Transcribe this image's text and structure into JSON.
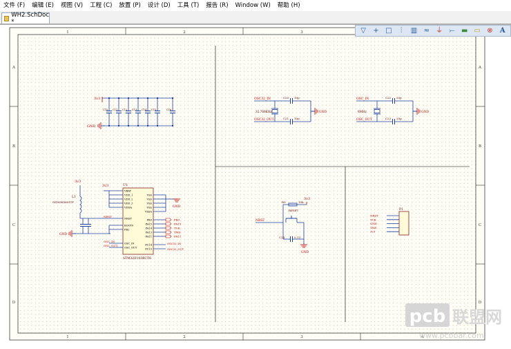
{
  "menu": [
    "文件 (F)",
    "编辑 (E)",
    "视图 (V)",
    "工程 (C)",
    "放置 (P)",
    "设计 (D)",
    "工具 (T)",
    "报告 (R)",
    "Window (W)",
    "帮助 (H)"
  ],
  "tab": {
    "title": "WH2.SchDoc *"
  },
  "toolbar": {
    "icons": [
      "filter-icon",
      "cross-icon",
      "rectangle-select-icon",
      "align-icon",
      "component-icon",
      "wire-icon",
      "power-port-icon",
      "bus-icon",
      "sheet-symbol-icon",
      "port-icon",
      "no-erc-icon",
      "text-icon"
    ],
    "text_glyph": "A"
  },
  "frame": {
    "cols": [
      "1",
      "2",
      "3",
      "4"
    ],
    "rows": [
      "A",
      "B",
      "C",
      "D"
    ]
  },
  "schematic": {
    "decoupling": {
      "vcc": "3v3",
      "gnd": "GND",
      "caps": [
        "C10",
        "C11",
        "C12",
        "C13",
        "C14",
        "C15",
        "C16"
      ]
    },
    "osc32": {
      "net_in": "OSC32_IN",
      "net_out": "OSC32_OUT",
      "c_in": "C20",
      "c_out": "C21",
      "crystal": "32.768KHz",
      "val1": "10p",
      "val2": "10p",
      "gnd": "GND"
    },
    "osc8m": {
      "net_in": "OSC_IN",
      "net_out": "OSC_OUT",
      "c_in": "C22",
      "c_out": "C23",
      "crystal": "8MHz",
      "val1": "20p",
      "val2": "20p",
      "gnd": "GND"
    },
    "mcu": {
      "ref": "U1",
      "part": "STM32F103RCT6",
      "inductor": "L1",
      "inductor_part": "GZ1608D601TF",
      "vcc": "3v3",
      "vcc2": "3v3",
      "gnd": "GND",
      "gnd2": "GND",
      "left_pins": [
        "VBAT",
        "VDD_1",
        "VDD_2",
        "VDD_3",
        "VDDA",
        "NRST",
        "BOOT0",
        "PB2",
        "OSC_IN",
        "OSC_OUT"
      ],
      "right_pins": [
        "VSS",
        "VSS",
        "VSS",
        "VSS",
        "VSSA",
        "PB3",
        "PA15",
        "PA14",
        "PA13",
        "PA11",
        "PC14",
        "PC15"
      ],
      "net_left": [
        "NRST",
        "OSC_IN",
        "OSC_OUT"
      ],
      "net_right": [
        "PB3",
        "PA15",
        "TCK",
        "TMS",
        "PA11",
        "OSC32_IN",
        "OSC32_OUT"
      ]
    },
    "reset": {
      "vcc": "3v3",
      "r": "R9",
      "rv": "10k",
      "sw": "RESET",
      "net": "NRST",
      "c": "C24",
      "cv": "0.1U",
      "gnd": "GND"
    },
    "jtag": {
      "ref": "P1",
      "nets": [
        "NRST",
        "TCK",
        "GND",
        "TMS",
        "3v3"
      ]
    }
  },
  "watermark": {
    "brand": "pcb",
    "cn": "联盟网",
    "url": "www.pcbbar.com"
  }
}
